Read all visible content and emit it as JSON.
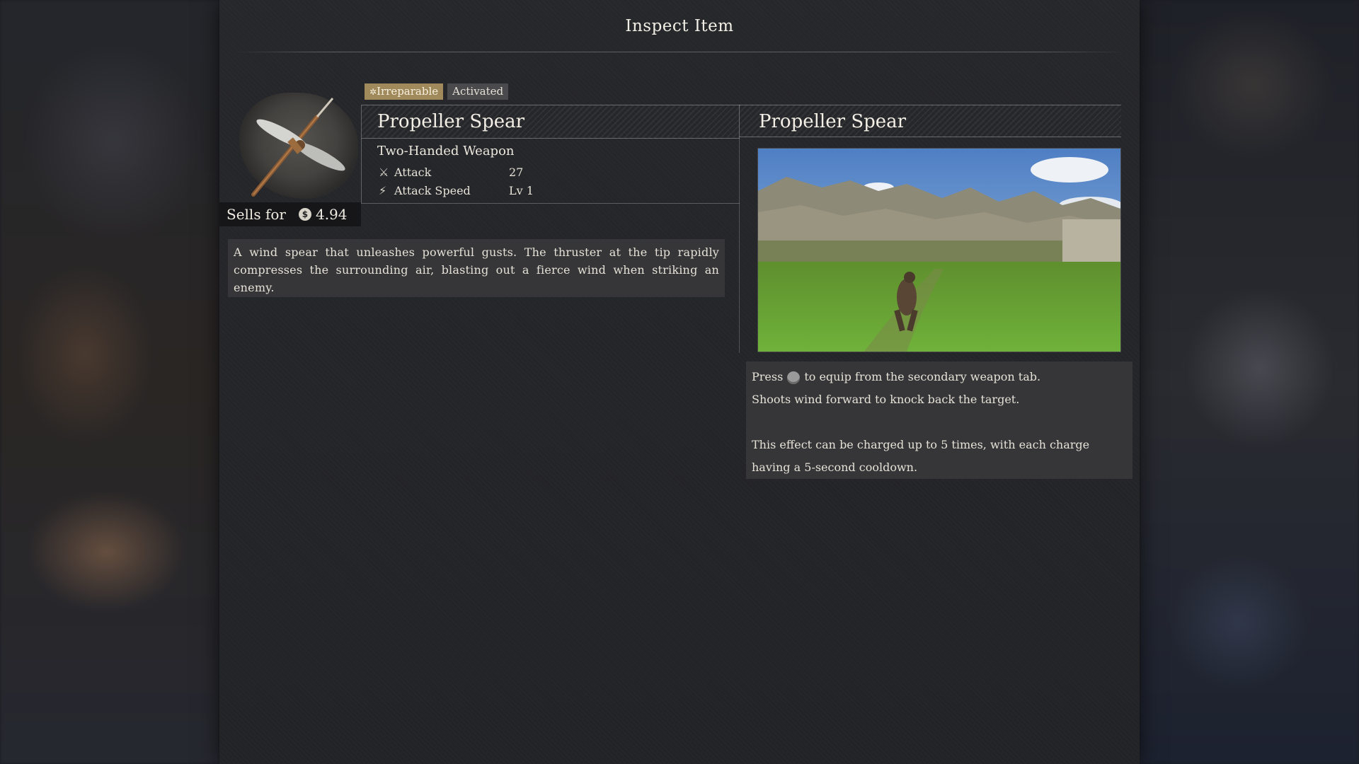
{
  "screen": {
    "title": "Inspect Item"
  },
  "item": {
    "name": "Propeller Spear",
    "type": "Two-Handed Weapon",
    "tags": [
      "Irreparable",
      "Activated"
    ],
    "sells_label": "Sells for",
    "sells_value": "4.94",
    "stats": [
      {
        "icon": "sword-icon",
        "label": "Attack",
        "value": "27"
      },
      {
        "icon": "speed-icon",
        "label": "Attack Speed",
        "value": "Lv 1"
      }
    ],
    "description": "A wind spear that unleashes powerful gusts. The thruster at the tip rapidly compresses the surrounding air, blasting out a fierce wind when striking an enemy."
  },
  "effect_panel": {
    "title": "Propeller Spear",
    "line1_pre": "Press",
    "line1_post": "to equip from the secondary weapon tab.",
    "line2": "Shoots wind forward to knock back the target.",
    "line3": "This effect can be charged up to 5 times, with each charge having a 5-second cooldown."
  },
  "colors": {
    "tag_irreparable": "#a08a5c",
    "tag_activated": "#4a4a4c",
    "panel_bg": "#232427"
  }
}
